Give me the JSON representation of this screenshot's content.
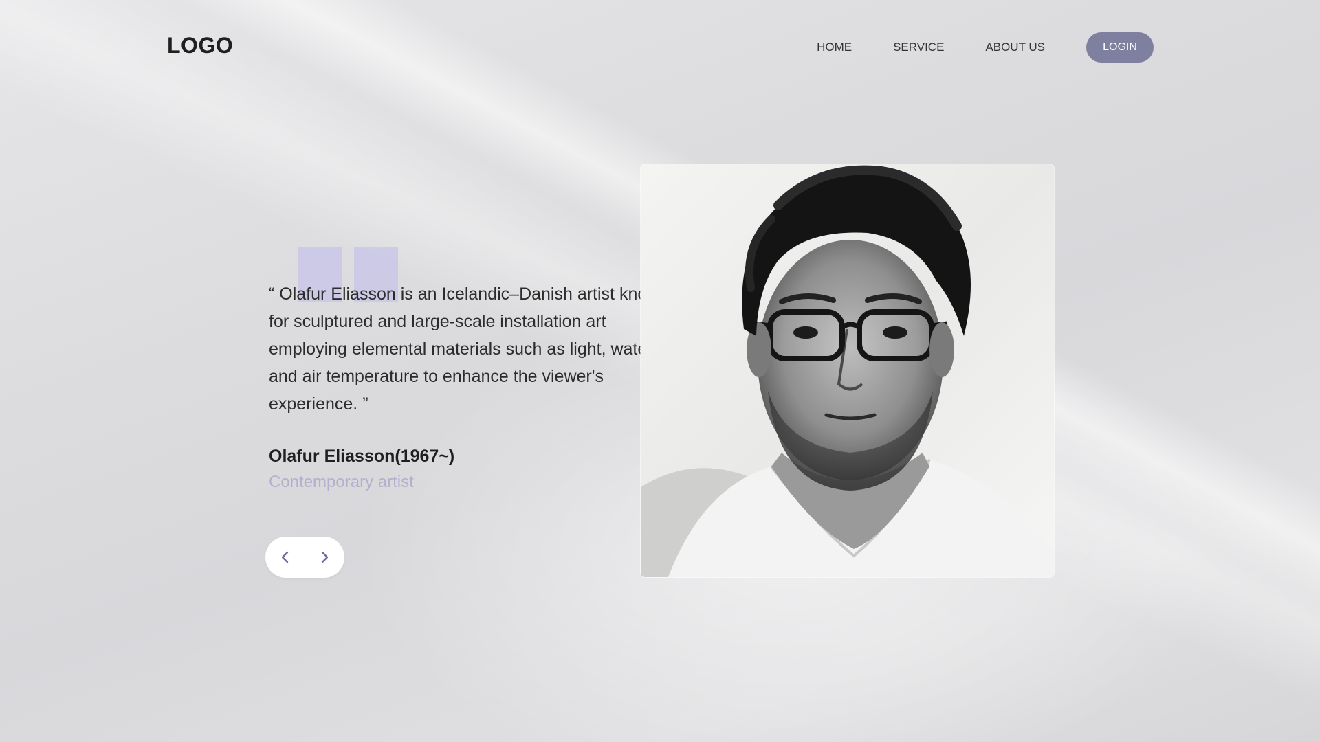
{
  "header": {
    "logo": "LOGO",
    "nav": [
      {
        "label": "HOME"
      },
      {
        "label": "SERVICE"
      },
      {
        "label": "ABOUT US"
      }
    ],
    "login_label": "LOGIN"
  },
  "testimonial": {
    "quote": "“ Olafur Eliasson is an Icelandic–Danish artist known for sculptured and large-scale installation art employing elemental materials such as light, water, and air temperature to enhance the viewer's experience. ”",
    "author": "Olafur Eliasson(1967~)",
    "role": "Contemporary artist"
  },
  "controls": {
    "prev_icon": "chevron-left-icon",
    "next_icon": "chevron-right-icon"
  },
  "portrait": {
    "subject": "black-and-white portrait of a man with glasses"
  },
  "colors": {
    "accent": "#7f7f9f",
    "quote_mark": "#c4c2e8",
    "role_text": "#b2b0cc",
    "arrow": "#6e6b9a"
  }
}
